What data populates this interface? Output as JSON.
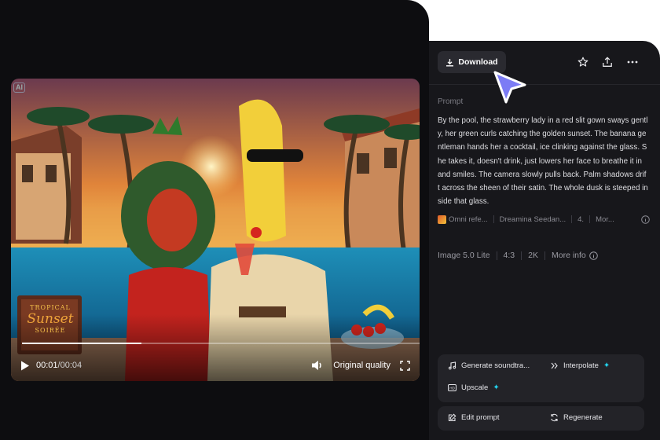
{
  "toolbar": {
    "download_label": "Download",
    "icons": [
      "download-icon",
      "star-icon",
      "share-icon",
      "more-icon"
    ]
  },
  "details": {
    "prompt_label": "Prompt",
    "prompt_text": "By the pool, the strawberry lady in a red slit gown sways gently, her green curls catching the golden sunset. The banana gentleman hands her a cocktail, ice clinking against the glass. She takes it, doesn't drink, just lowers her face to breathe it in and smiles. The camera slowly pulls back. Palm shadows drift across the sheen of their satin. The whole dusk is steeped inside that glass.",
    "references": [
      "Omni refe...",
      "Dreamina Seedan...",
      "4.",
      "Mor..."
    ],
    "meta": {
      "model": "Image 5.0 Lite",
      "ratio": "4:3",
      "resolution": "2K",
      "more_info": "More info"
    }
  },
  "actions": {
    "generate_soundtrack": "Generate soundtra...",
    "interpolate": "Interpolate",
    "upscale": "Upscale",
    "edit_prompt": "Edit prompt",
    "regenerate": "Regenerate"
  },
  "player": {
    "ai_badge": "AI",
    "current_time": "00:01",
    "total_time": "/00:04",
    "quality": "Original quality",
    "progress": 0.3,
    "sign_line1": "TROPICAL",
    "sign_line2": "Sunset",
    "sign_line3": "SOIRÉE"
  },
  "colors": {
    "accent": "#22d3ee",
    "cursor": "#7c7cf5",
    "panel_bg": "#17171b",
    "page_bg": "#0d0d10"
  }
}
